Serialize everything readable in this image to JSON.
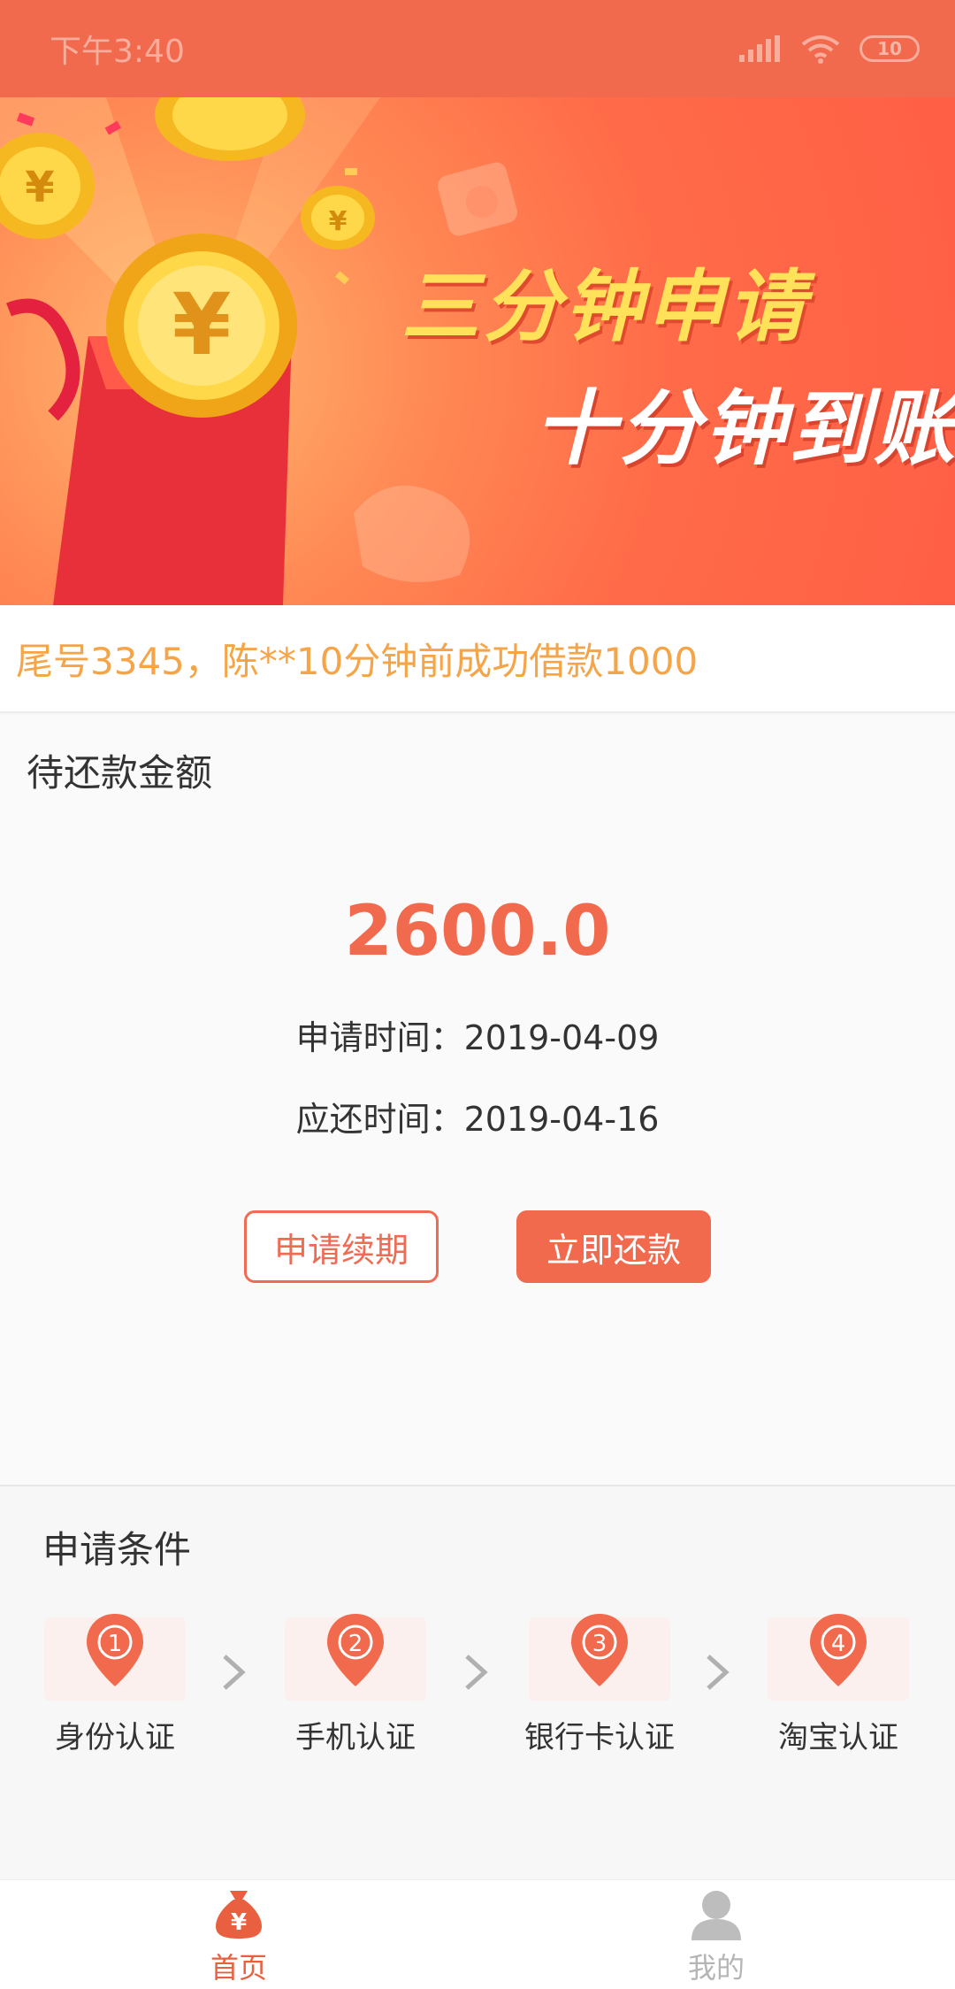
{
  "status_bar": {
    "time": "下午3:40",
    "battery": "10",
    "signal_icon": "signal-icon",
    "wifi_icon": "wifi-icon",
    "battery_icon": "battery-icon"
  },
  "banner": {
    "line1": "三分钟申请",
    "line2": "十分钟到账"
  },
  "ticker": {
    "text": "尾号3345，陈**10分钟前成功借款1000"
  },
  "repayment": {
    "title": "待还款金额",
    "amount": "2600.0",
    "apply_time": "申请时间：2019-04-09",
    "due_time": "应还时间：2019-04-16",
    "extend_button": "申请续期",
    "repay_button": "立即还款"
  },
  "conditions": {
    "title": "申请条件",
    "steps": [
      {
        "number": "1",
        "label": "身份认证"
      },
      {
        "number": "2",
        "label": "手机认证"
      },
      {
        "number": "3",
        "label": "银行卡认证"
      },
      {
        "number": "4",
        "label": "淘宝认证"
      }
    ]
  },
  "bottom_nav": {
    "items": [
      {
        "label": "首页",
        "icon": "money-bag-icon",
        "active": true
      },
      {
        "label": "我的",
        "icon": "user-icon",
        "active": false
      }
    ]
  },
  "colors": {
    "primary": "#f26a4d",
    "ticker": "#f5a548",
    "inactive": "#b5b5b5"
  }
}
